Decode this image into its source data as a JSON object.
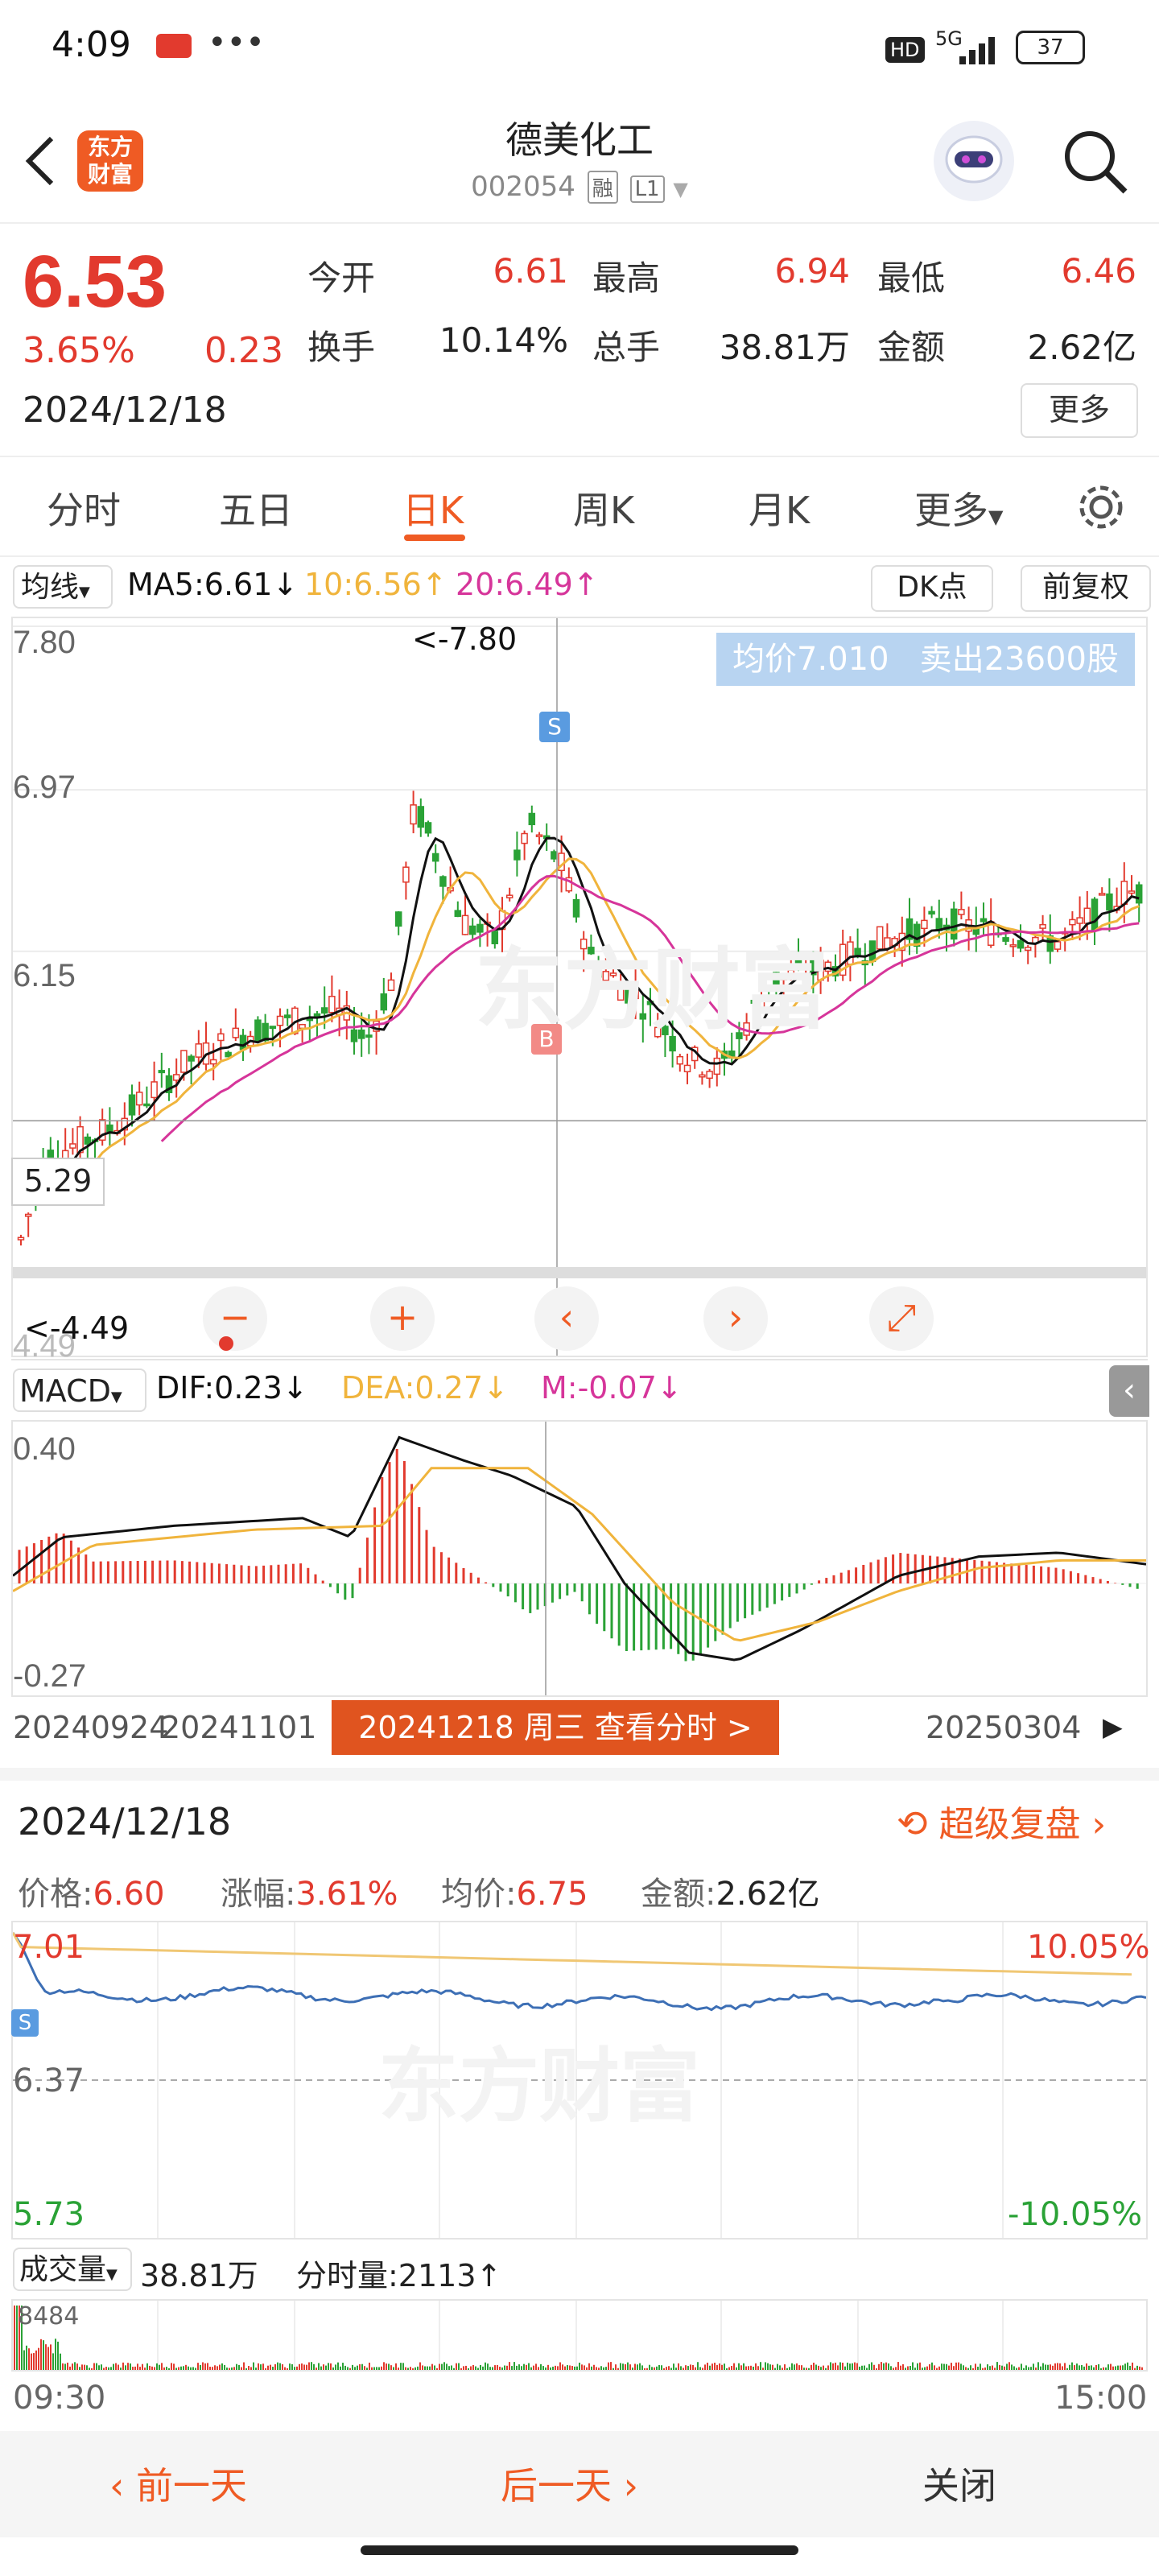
{
  "status_bar": {
    "time": "4:09",
    "signal": "5G",
    "hd": "HD",
    "battery": "37"
  },
  "header": {
    "title": "德美化工",
    "code": "002054",
    "tag_margin": "融",
    "tag_level": "L1"
  },
  "quote": {
    "price": "6.53",
    "change_pct": "3.65%",
    "change": "0.23",
    "date": "2024/12/18",
    "open_label": "今开",
    "open": "6.61",
    "high_label": "最高",
    "high": "6.94",
    "low_label": "最低",
    "low": "6.46",
    "turnover_label": "换手",
    "turnover": "10.14%",
    "volume_label": "总手",
    "volume": "38.81万",
    "amount_label": "金额",
    "amount": "2.62亿",
    "more": "更多"
  },
  "tabs": [
    "分时",
    "五日",
    "日K",
    "周K",
    "月K",
    "更多"
  ],
  "active_tab": "日K",
  "ma_bar": {
    "selector": "均线",
    "ma5": "MA5:6.61",
    "ma10": "10:6.56",
    "ma20": "20:6.49",
    "dk": "DK点",
    "adjust": "前复权"
  },
  "kline": {
    "y_labels": [
      "7.80",
      "6.97",
      "6.15",
      "5.",
      "4.49"
    ],
    "crosshair_price": "5.29",
    "max_marker": "<-7.80",
    "min_marker": "<-4.49",
    "info_box": "均价7.010   卖出23600股",
    "sell_marker": "S",
    "buy_marker": "B",
    "colors": {
      "up": "#e23a2e",
      "down": "#2aa236",
      "ma5": "#111111",
      "ma10": "#f0b43c",
      "ma20": "#d6359a"
    }
  },
  "macd": {
    "selector": "MACD",
    "dif": "DIF:0.23",
    "dea": "DEA:0.27",
    "m": "M:-0.07",
    "y_top": "0.40",
    "y_bottom": "-0.27"
  },
  "timeline": {
    "date_left": "20240924",
    "date_mid": "20241101",
    "date_right": "20250304",
    "highlight": "20241218 周三 查看分时 >"
  },
  "intraday": {
    "date": "2024/12/18",
    "super_review": "超级复盘",
    "price_label": "价格:",
    "price": "6.60",
    "pct_label": "涨幅:",
    "pct": "3.61%",
    "avg_label": "均价:",
    "avg": "6.75",
    "amount_label": "金额:",
    "amount": "2.62亿",
    "y_top": "7.01",
    "y_mid": "6.37",
    "y_bottom": "5.73",
    "pct_top": "10.05%",
    "pct_bottom": "-10.05%",
    "sell_marker": "S",
    "vol_selector": "成交量",
    "vol_total": "38.81万",
    "tick_vol": "分时量:2113",
    "vol_max": "8484",
    "time_start": "09:30",
    "time_end": "15:00"
  },
  "bottom_nav": {
    "prev": "前一天",
    "next": "后一天",
    "close": "关闭"
  },
  "watermark": "东方财富"
}
